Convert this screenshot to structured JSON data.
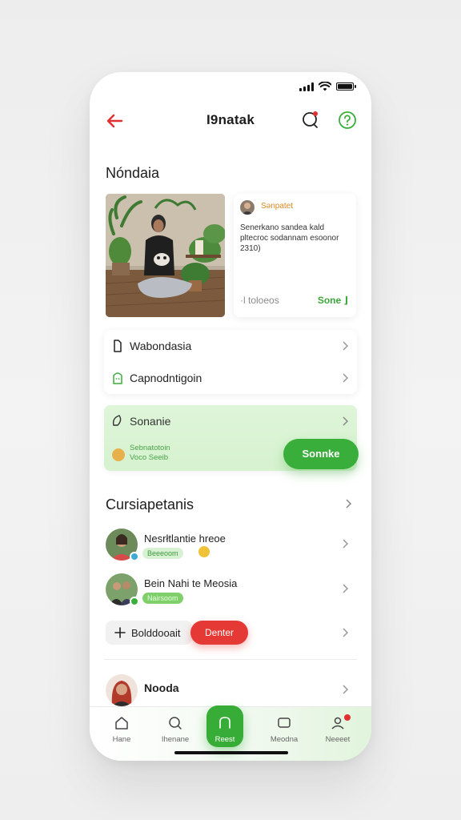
{
  "status": {
    "signal": "signal-icon",
    "wifi": "wifi-icon",
    "battery": "battery-icon"
  },
  "header": {
    "title": "Ι9natak",
    "back_icon": "arrow-left-icon",
    "chat_icon": "chat-bubble-icon",
    "help_icon": "help-circle-icon"
  },
  "section1": {
    "title": "Nóndaia"
  },
  "feature": {
    "author": "Sənpatet",
    "text": "Senerkano sandea kald pltecroc sodannam esoonor 2310)",
    "meta": "·l toloeos",
    "action": "Sone ⌋"
  },
  "links": [
    {
      "label": "Wabondasia",
      "icon": "bag-icon"
    },
    {
      "label": "Capnodntigoin",
      "icon": "smile-bag-icon"
    }
  ],
  "promo": {
    "title": "Sonanie",
    "sub_line1": "Sebnatotoin",
    "sub_line2": "Voco Seeib",
    "button": "Sonnke",
    "icon": "leaf-icon"
  },
  "section2": {
    "title": "Cursiapetanis"
  },
  "list": [
    {
      "title": "Nesrłtlantie hreoe",
      "badge": "Beeeoom",
      "presence_color": "#3fa9d6"
    },
    {
      "title": "Bein Nahi te Meosia",
      "badge": "Nairsoom",
      "presence_color": "#3aae3a"
    }
  ],
  "actions": {
    "add_label": "Bolddooait",
    "red_button": "Denter"
  },
  "bottom_item": {
    "title": "Nooda"
  },
  "nav": [
    {
      "label": "Hane",
      "icon": "home-icon"
    },
    {
      "label": "Ihenane",
      "icon": "search-icon"
    },
    {
      "label": "Reest",
      "icon": "chat-icon"
    },
    {
      "label": "Meodna",
      "icon": "message-icon"
    },
    {
      "label": "Neeeet",
      "icon": "profile-icon"
    }
  ],
  "colors": {
    "accent_green": "#3aae3a",
    "accent_red": "#e53935",
    "orange": "#d98a22"
  }
}
